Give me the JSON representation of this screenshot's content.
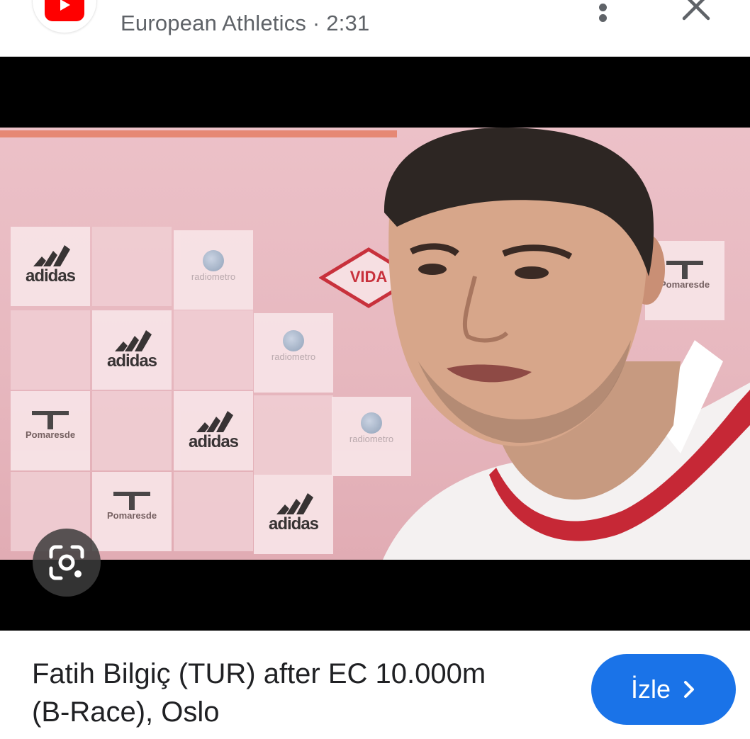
{
  "header": {
    "source": "European Athletics",
    "separator": " · ",
    "duration": "2:31",
    "icons": [
      "youtube-logo-icon",
      "more-vertical-icon",
      "close-icon"
    ]
  },
  "video": {
    "background_brands": {
      "adidas": "adidas",
      "radio": "radiometro",
      "pomar": "Pomaresde",
      "vida": "VIDA"
    },
    "overlay_icons": [
      "lens-camera-icon"
    ]
  },
  "result": {
    "title_line1": "Fatih Bilgiç (TUR) after EC 10.000m",
    "title_line2": "(B-Race), Oslo",
    "watch_label": "İzle",
    "watch_icon": "chevron-right-icon"
  },
  "colors": {
    "youtube_red": "#ff0000",
    "accent_blue": "#1a73e8",
    "text_primary": "#202124",
    "text_secondary": "#5f6368"
  }
}
